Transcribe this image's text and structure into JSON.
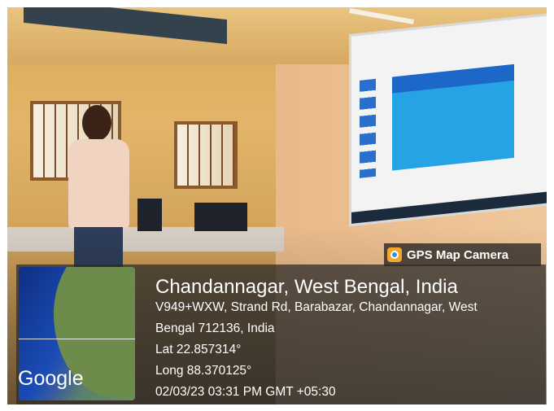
{
  "badge": {
    "label": "GPS Map Camera",
    "icon": "map-camera-icon",
    "icon_color": "#f4a62a"
  },
  "map": {
    "logo": "Google"
  },
  "location": {
    "place": "Chandannagar, West Bengal, India",
    "address_line1": "V949+WXW, Strand Rd, Barabazar, Chandannagar, West",
    "address_line2": "Bengal 712136, India",
    "lat": "Lat 22.857314°",
    "long": "Long 88.370125°",
    "datetime": "02/03/23 03:31 PM GMT +05:30"
  }
}
